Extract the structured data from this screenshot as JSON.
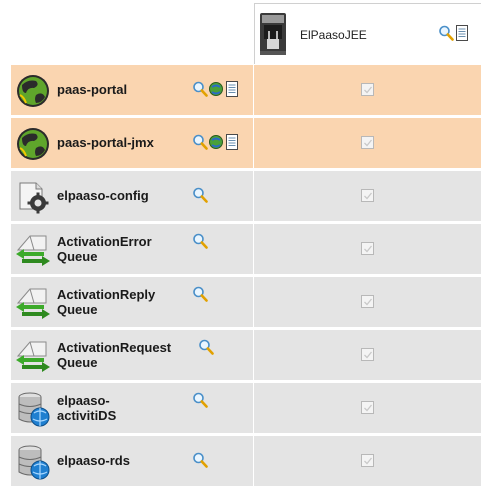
{
  "header": {
    "server_name": "ElPaasoJEE",
    "server_icon": "espresso-machine-icon",
    "actions": [
      "search-icon",
      "document-icon"
    ]
  },
  "colors": {
    "highlight_row": "#fad5b0",
    "normal_row": "#e4e4e4"
  },
  "rows": [
    {
      "label": "paas-portal",
      "icon": "globe-app-icon",
      "actions": [
        "search-icon",
        "globe-refresh-icon",
        "document-icon"
      ],
      "checked": true,
      "disabled": true
    },
    {
      "label": "paas-portal-jmx",
      "icon": "globe-app-icon",
      "actions": [
        "search-icon",
        "globe-refresh-icon",
        "document-icon"
      ],
      "checked": true,
      "disabled": true
    },
    {
      "label": "elpaaso-config",
      "icon": "config-gear-icon",
      "actions": [
        "search-icon"
      ],
      "checked": true,
      "disabled": true
    },
    {
      "label": "ActivationErrorQueue",
      "line1": "ActivationError",
      "line2": "Queue",
      "icon": "queue-arrows-icon",
      "actions": [
        "search-icon"
      ],
      "checked": true,
      "disabled": true
    },
    {
      "label": "ActivationReplyQueue",
      "line1": "ActivationReply",
      "line2": "Queue",
      "icon": "queue-arrows-icon",
      "actions": [
        "search-icon"
      ],
      "checked": true,
      "disabled": true
    },
    {
      "label": "ActivationRequestQueue",
      "line1": "ActivationRequest",
      "line2": "Queue",
      "icon": "queue-arrows-icon",
      "actions": [
        "search-icon"
      ],
      "checked": true,
      "disabled": true
    },
    {
      "label": "elpaaso-activitiDS",
      "line1": "elpaaso-",
      "line2": "activitiDS",
      "icon": "database-globe-icon",
      "actions": [
        "search-icon"
      ],
      "checked": true,
      "disabled": true
    },
    {
      "label": "elpaaso-rds",
      "icon": "database-globe-icon",
      "actions": [
        "search-icon"
      ],
      "checked": true,
      "disabled": true
    }
  ]
}
